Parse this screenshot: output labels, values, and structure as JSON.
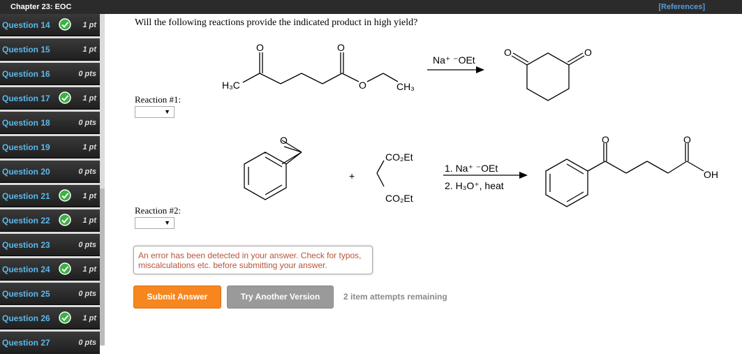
{
  "header": {
    "chapter_title": "Chapter 23: EOC",
    "references_label": "[References]"
  },
  "sidebar": {
    "items": [
      {
        "label": "Question 14",
        "points": "1 pt",
        "completed": true
      },
      {
        "label": "Question 15",
        "points": "1 pt",
        "completed": false
      },
      {
        "label": "Question 16",
        "points": "0 pts",
        "completed": false
      },
      {
        "label": "Question 17",
        "points": "1 pt",
        "completed": true
      },
      {
        "label": "Question 18",
        "points": "0 pts",
        "completed": false
      },
      {
        "label": "Question 19",
        "points": "1 pt",
        "completed": false
      },
      {
        "label": "Question 20",
        "points": "0 pts",
        "completed": false
      },
      {
        "label": "Question 21",
        "points": "1 pt",
        "completed": true
      },
      {
        "label": "Question 22",
        "points": "1 pt",
        "completed": true
      },
      {
        "label": "Question 23",
        "points": "0 pts",
        "completed": false
      },
      {
        "label": "Question 24",
        "points": "1 pt",
        "completed": true
      },
      {
        "label": "Question 25",
        "points": "0 pts",
        "completed": false
      },
      {
        "label": "Question 26",
        "points": "1 pt",
        "completed": true
      },
      {
        "label": "Question 27",
        "points": "0 pts",
        "completed": false
      }
    ],
    "check_color": "#3cb043"
  },
  "main": {
    "question": "Will the following reactions provide the indicated product in high yield?",
    "reaction1": {
      "label": "Reaction #1:",
      "selected": "",
      "reagent": "Na⁺ ⁻OEt"
    },
    "reaction2": {
      "label": "Reaction #2:",
      "selected": "",
      "reagent_line1": "1. Na⁺ ⁻OEt",
      "reagent_line2": "2. H₃O⁺, heat"
    },
    "chem_labels": {
      "h3c": "H₃C",
      "o": "O",
      "ch3": "CH₃",
      "co2et": "CO₂Et",
      "plus": "+",
      "oh": "OH"
    },
    "error_message": "An error has been detected in your answer. Check for typos, miscalculations etc. before submitting your answer.",
    "submit_label": "Submit Answer",
    "try_label": "Try Another Version",
    "attempts": "2 item attempts remaining"
  },
  "colors": {
    "submit": "#f7861f",
    "try": "#9a9a9a",
    "error_text": "#b5543a",
    "link": "#5bb8ec"
  }
}
